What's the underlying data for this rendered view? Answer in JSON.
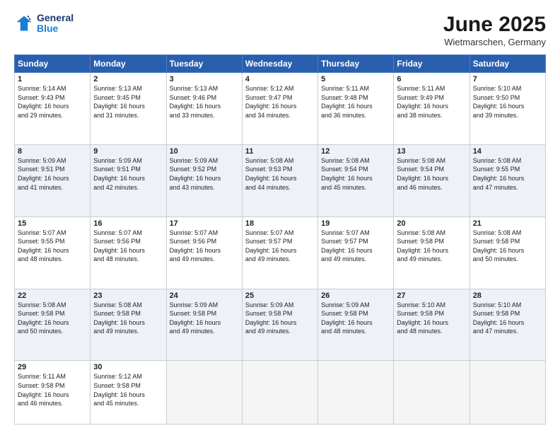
{
  "header": {
    "logo_line1": "General",
    "logo_line2": "Blue",
    "title": "June 2025",
    "subtitle": "Wietmarschen, Germany"
  },
  "days_of_week": [
    "Sunday",
    "Monday",
    "Tuesday",
    "Wednesday",
    "Thursday",
    "Friday",
    "Saturday"
  ],
  "weeks": [
    [
      {
        "day": 1,
        "info": "Sunrise: 5:14 AM\nSunset: 9:43 PM\nDaylight: 16 hours\nand 29 minutes."
      },
      {
        "day": 2,
        "info": "Sunrise: 5:13 AM\nSunset: 9:45 PM\nDaylight: 16 hours\nand 31 minutes."
      },
      {
        "day": 3,
        "info": "Sunrise: 5:13 AM\nSunset: 9:46 PM\nDaylight: 16 hours\nand 33 minutes."
      },
      {
        "day": 4,
        "info": "Sunrise: 5:12 AM\nSunset: 9:47 PM\nDaylight: 16 hours\nand 34 minutes."
      },
      {
        "day": 5,
        "info": "Sunrise: 5:11 AM\nSunset: 9:48 PM\nDaylight: 16 hours\nand 36 minutes."
      },
      {
        "day": 6,
        "info": "Sunrise: 5:11 AM\nSunset: 9:49 PM\nDaylight: 16 hours\nand 38 minutes."
      },
      {
        "day": 7,
        "info": "Sunrise: 5:10 AM\nSunset: 9:50 PM\nDaylight: 16 hours\nand 39 minutes."
      }
    ],
    [
      {
        "day": 8,
        "info": "Sunrise: 5:09 AM\nSunset: 9:51 PM\nDaylight: 16 hours\nand 41 minutes."
      },
      {
        "day": 9,
        "info": "Sunrise: 5:09 AM\nSunset: 9:51 PM\nDaylight: 16 hours\nand 42 minutes."
      },
      {
        "day": 10,
        "info": "Sunrise: 5:09 AM\nSunset: 9:52 PM\nDaylight: 16 hours\nand 43 minutes."
      },
      {
        "day": 11,
        "info": "Sunrise: 5:08 AM\nSunset: 9:53 PM\nDaylight: 16 hours\nand 44 minutes."
      },
      {
        "day": 12,
        "info": "Sunrise: 5:08 AM\nSunset: 9:54 PM\nDaylight: 16 hours\nand 45 minutes."
      },
      {
        "day": 13,
        "info": "Sunrise: 5:08 AM\nSunset: 9:54 PM\nDaylight: 16 hours\nand 46 minutes."
      },
      {
        "day": 14,
        "info": "Sunrise: 5:08 AM\nSunset: 9:55 PM\nDaylight: 16 hours\nand 47 minutes."
      }
    ],
    [
      {
        "day": 15,
        "info": "Sunrise: 5:07 AM\nSunset: 9:55 PM\nDaylight: 16 hours\nand 48 minutes."
      },
      {
        "day": 16,
        "info": "Sunrise: 5:07 AM\nSunset: 9:56 PM\nDaylight: 16 hours\nand 48 minutes."
      },
      {
        "day": 17,
        "info": "Sunrise: 5:07 AM\nSunset: 9:56 PM\nDaylight: 16 hours\nand 49 minutes."
      },
      {
        "day": 18,
        "info": "Sunrise: 5:07 AM\nSunset: 9:57 PM\nDaylight: 16 hours\nand 49 minutes."
      },
      {
        "day": 19,
        "info": "Sunrise: 5:07 AM\nSunset: 9:57 PM\nDaylight: 16 hours\nand 49 minutes."
      },
      {
        "day": 20,
        "info": "Sunrise: 5:08 AM\nSunset: 9:58 PM\nDaylight: 16 hours\nand 49 minutes."
      },
      {
        "day": 21,
        "info": "Sunrise: 5:08 AM\nSunset: 9:58 PM\nDaylight: 16 hours\nand 50 minutes."
      }
    ],
    [
      {
        "day": 22,
        "info": "Sunrise: 5:08 AM\nSunset: 9:58 PM\nDaylight: 16 hours\nand 50 minutes."
      },
      {
        "day": 23,
        "info": "Sunrise: 5:08 AM\nSunset: 9:58 PM\nDaylight: 16 hours\nand 49 minutes."
      },
      {
        "day": 24,
        "info": "Sunrise: 5:09 AM\nSunset: 9:58 PM\nDaylight: 16 hours\nand 49 minutes."
      },
      {
        "day": 25,
        "info": "Sunrise: 5:09 AM\nSunset: 9:58 PM\nDaylight: 16 hours\nand 49 minutes."
      },
      {
        "day": 26,
        "info": "Sunrise: 5:09 AM\nSunset: 9:58 PM\nDaylight: 16 hours\nand 48 minutes."
      },
      {
        "day": 27,
        "info": "Sunrise: 5:10 AM\nSunset: 9:58 PM\nDaylight: 16 hours\nand 48 minutes."
      },
      {
        "day": 28,
        "info": "Sunrise: 5:10 AM\nSunset: 9:58 PM\nDaylight: 16 hours\nand 47 minutes."
      }
    ],
    [
      {
        "day": 29,
        "info": "Sunrise: 5:11 AM\nSunset: 9:58 PM\nDaylight: 16 hours\nand 46 minutes."
      },
      {
        "day": 30,
        "info": "Sunrise: 5:12 AM\nSunset: 9:58 PM\nDaylight: 16 hours\nand 45 minutes."
      },
      null,
      null,
      null,
      null,
      null
    ]
  ]
}
